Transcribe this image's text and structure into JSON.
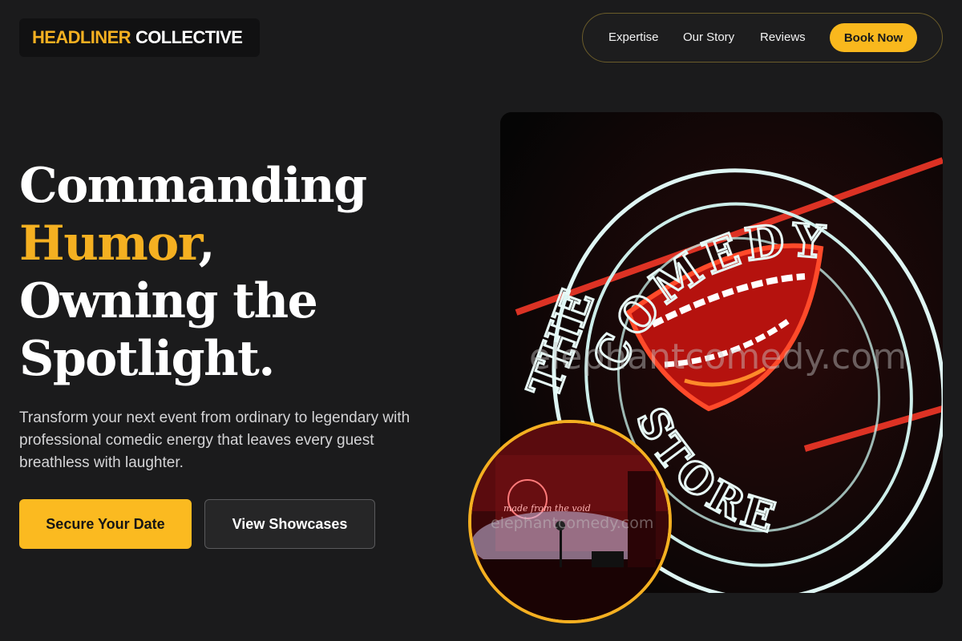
{
  "brand": {
    "part1": "HEADLINER",
    "part2": "COLLECTIVE"
  },
  "nav": {
    "items": [
      "Expertise",
      "Our Story",
      "Reviews"
    ],
    "cta": "Book Now"
  },
  "hero": {
    "line1": "Commanding",
    "highlight": "Humor",
    "comma": ",",
    "line3": "Owning the",
    "line4": "Spotlight.",
    "subtext": "Transform your next event from ordinary to legendary with professional comedic energy that leaves every guest breathless with laughter.",
    "primary_cta": "Secure Your Date",
    "secondary_cta": "View Showcases"
  },
  "images": {
    "main_sign_text": "THE COMEDY STORE",
    "inset_sign_text": "made from the void",
    "watermark": "elephantcomedy.com"
  },
  "colors": {
    "accent": "#f5b021",
    "background": "#1b1b1c"
  }
}
